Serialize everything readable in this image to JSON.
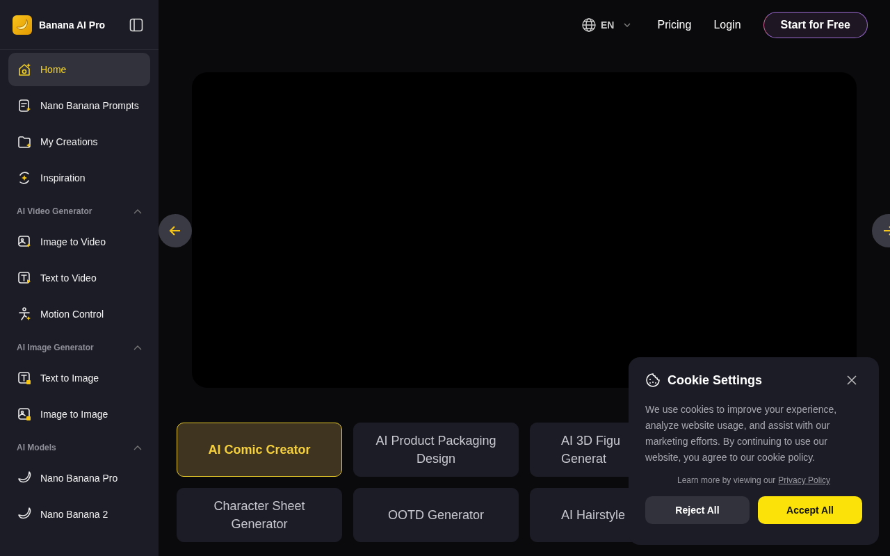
{
  "brand": {
    "name": "Banana AI Pro"
  },
  "sidebar": {
    "items": [
      {
        "kind": "link",
        "label": "Home",
        "selected": true
      },
      {
        "kind": "link",
        "label": "Nano Banana Prompts",
        "selected": false
      },
      {
        "kind": "link",
        "label": "My Creations",
        "selected": false
      },
      {
        "kind": "link",
        "label": "Inspiration",
        "selected": false
      },
      {
        "kind": "section",
        "label": "AI Video Generator",
        "expanded": true
      },
      {
        "kind": "link",
        "label": "Image to Video",
        "selected": false
      },
      {
        "kind": "link",
        "label": "Text to Video",
        "selected": false
      },
      {
        "kind": "link",
        "label": "Motion Control",
        "selected": false
      },
      {
        "kind": "section",
        "label": "AI Image Generator",
        "expanded": true
      },
      {
        "kind": "link",
        "label": "Text to Image",
        "selected": false
      },
      {
        "kind": "link",
        "label": "Image to Image",
        "selected": false
      },
      {
        "kind": "section",
        "label": "AI Models",
        "expanded": true
      },
      {
        "kind": "link",
        "label": "Nano Banana Pro",
        "selected": false
      },
      {
        "kind": "link",
        "label": "Nano Banana 2",
        "selected": false
      }
    ]
  },
  "header": {
    "language": "EN",
    "links": [
      "Pricing",
      "Login"
    ],
    "cta": "Start for Free"
  },
  "tools": [
    {
      "kind": "full",
      "lines": [
        "AI Comic Creator"
      ],
      "selected": true
    },
    {
      "kind": "full",
      "lines": [
        "AI Product Packaging",
        "Design"
      ],
      "selected": false
    },
    {
      "kind": "clipped",
      "lines": [
        "AI 3D Figu",
        "Generat"
      ],
      "selected": false
    },
    {
      "kind": "full",
      "lines": [
        "Character Sheet",
        "Generator"
      ],
      "selected": false
    },
    {
      "kind": "full",
      "lines": [
        "OOTD Generator"
      ],
      "selected": false
    },
    {
      "kind": "clipped",
      "lines": [
        "AI Hairstyle"
      ],
      "selected": false
    }
  ],
  "cookie_dialog": {
    "title": "Cookie Settings",
    "body": "We use cookies to improve your experience, analyze website usage, and assist with our marketing efforts. By continuing to use our website, you agree to our cookie policy.",
    "note": "Learn more by viewing our",
    "link": "Privacy Policy",
    "buttons": [
      {
        "kind": "secondary",
        "label": "Reject All"
      },
      {
        "kind": "primary",
        "label": "Accept All"
      }
    ]
  }
}
